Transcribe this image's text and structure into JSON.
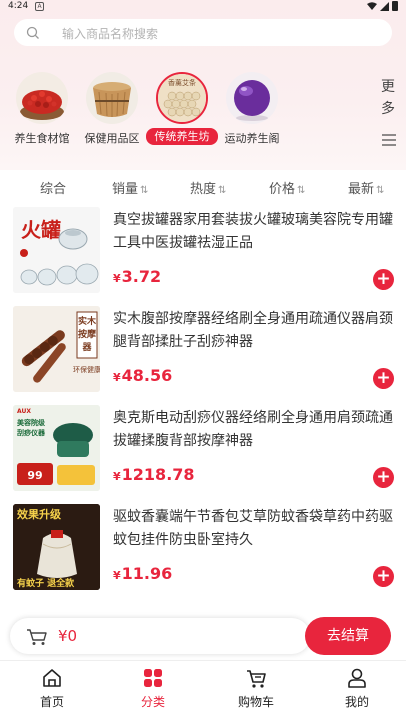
{
  "status_bar": {
    "time": "4:24"
  },
  "search": {
    "placeholder": "输入商品名称搜索"
  },
  "categories": [
    {
      "label": "养生食材馆",
      "icon": "goji-berries-image",
      "active": false
    },
    {
      "label": "保健用品区",
      "icon": "wooden-foot-tub-image",
      "active": false
    },
    {
      "label": "传统养生坊",
      "icon": "moxa-sticks-image",
      "active": true
    },
    {
      "label": "运动养生阁",
      "icon": "yoga-ball-image",
      "active": false
    }
  ],
  "more": {
    "label": "更多"
  },
  "sort_tabs": [
    {
      "label": "综合",
      "arrow": ""
    },
    {
      "label": "销量",
      "arrow": "⇅"
    },
    {
      "label": "热度",
      "arrow": "⇅"
    },
    {
      "label": "价格",
      "arrow": "⇅"
    },
    {
      "label": "最新",
      "arrow": "⇅"
    }
  ],
  "products": [
    {
      "title": "真空拔罐器家用套装拔火罐玻璃美容院专用罐工具中医拔罐祛湿正品",
      "currency": "¥",
      "price": "3.72",
      "image_text": "火罐"
    },
    {
      "title": "实木腹部按摩器经络刷全身通用疏通仪器肩颈腿背部揉肚子刮痧神器",
      "currency": "¥",
      "price": "48.56",
      "image_text": "实木按摩器",
      "image_subtext": "环保健康"
    },
    {
      "title": "奥克斯电动刮痧仪器经络刷全身通用肩颈疏通拔罐揉腹背部按摩神器",
      "currency": "¥",
      "price": "1218.78",
      "image_text": "美容院级刮痧仪器",
      "image_brand": "AUX",
      "image_price": "99"
    },
    {
      "title": "驱蚊香囊端午节香包艾草防蚊香袋草药中药驱蚊包挂件防虫卧室持久",
      "currency": "¥",
      "price": "11.96",
      "image_text": "效果升级",
      "image_subtext": "有蚊子 退全款"
    }
  ],
  "cart": {
    "total": "¥0",
    "checkout_label": "去结算"
  },
  "tabs": [
    {
      "label": "首页",
      "icon": "home-icon",
      "active": false
    },
    {
      "label": "分类",
      "icon": "category-icon",
      "active": true
    },
    {
      "label": "购物车",
      "icon": "cart-icon",
      "active": false
    },
    {
      "label": "我的",
      "icon": "user-icon",
      "active": false
    }
  ],
  "colors": {
    "accent": "#e8253d",
    "top_background": "#fbeced"
  }
}
